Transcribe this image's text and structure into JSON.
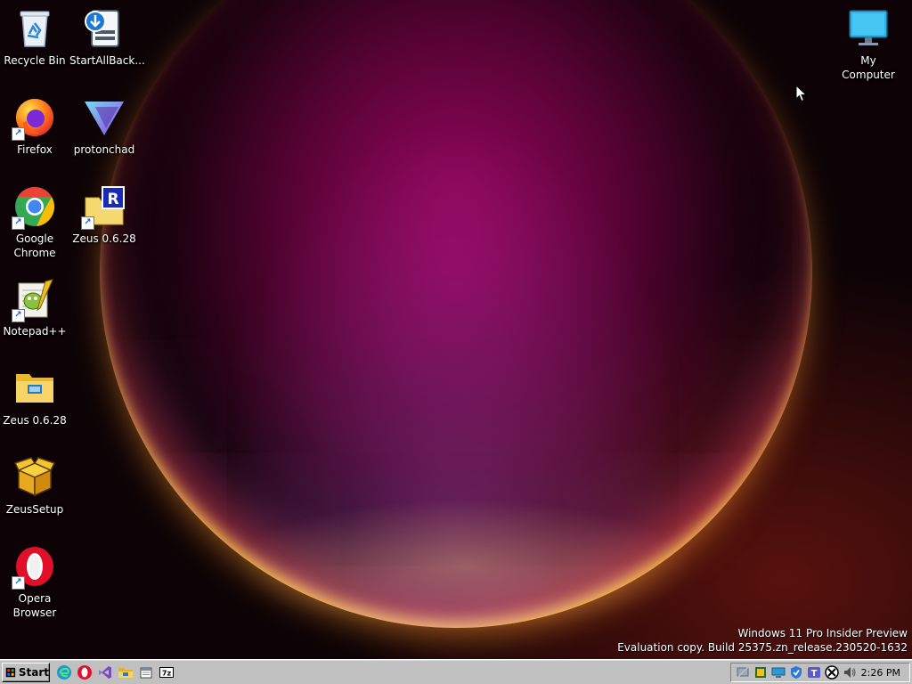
{
  "desktop": {
    "icons": [
      {
        "id": "recycle-bin",
        "label": "Recycle Bin"
      },
      {
        "id": "startallback",
        "label": "StartAllBack..."
      },
      {
        "id": "my-computer",
        "label": "My Computer"
      },
      {
        "id": "firefox",
        "label": "Firefox"
      },
      {
        "id": "protonchad",
        "label": "protonchad"
      },
      {
        "id": "google-chrome",
        "label": "Google Chrome"
      },
      {
        "id": "zeus-shortcut",
        "label": "Zeus 0.6.28"
      },
      {
        "id": "notepadpp",
        "label": "Notepad++"
      },
      {
        "id": "zeus-folder",
        "label": "Zeus 0.6.28"
      },
      {
        "id": "zeussetup",
        "label": "ZeusSetup"
      },
      {
        "id": "opera",
        "label": "Opera Browser"
      }
    ],
    "watermark": {
      "line1": "Windows 11 Pro Insider Preview",
      "line2": "Evaluation copy. Build 25375.zn_release.230520-1632"
    }
  },
  "taskbar": {
    "start_label": "Start",
    "quick_launch": [
      {
        "name": "edge-icon"
      },
      {
        "name": "opera-icon"
      },
      {
        "name": "visual-studio-icon"
      },
      {
        "name": "file-explorer-icon"
      },
      {
        "name": "calendar-icon"
      },
      {
        "name": "7zip-icon"
      }
    ],
    "tray_icons": [
      {
        "name": "network-icon"
      },
      {
        "name": "app-tray-icon"
      },
      {
        "name": "display-icon"
      },
      {
        "name": "security-icon"
      },
      {
        "name": "teams-icon"
      },
      {
        "name": "xbox-icon"
      },
      {
        "name": "volume-icon"
      }
    ],
    "clock": "2:26 PM"
  },
  "colors": {
    "taskbar_bg": "#c0c0c0",
    "desktop_bg": "#0d0306",
    "label_text": "#ffffff"
  }
}
